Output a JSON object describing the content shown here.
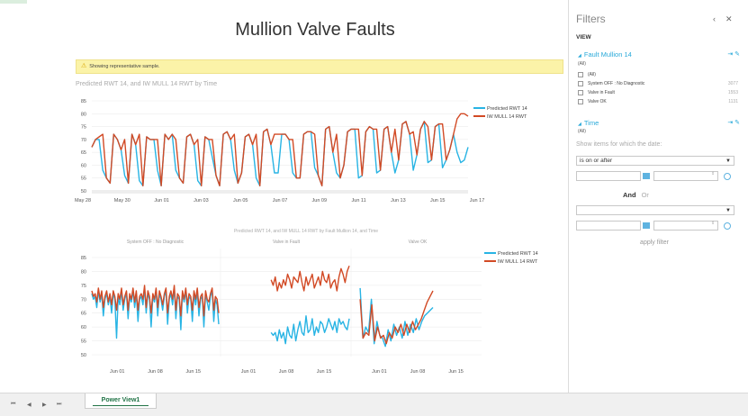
{
  "report": {
    "title": "Mullion Valve Faults",
    "notice": "Showing representative sample.",
    "chart1_title": "Predicted RWT 14, and IW MULL 14 RWT by Time",
    "chart2_title": "Predicted RWT 14, and IW MULL 14 RWT by Fault Mullion 14, and Time"
  },
  "colors": {
    "predicted": "#28b4e4",
    "iw_mull": "#d24a25",
    "accent": "#28a9d9",
    "sheet_tab": "#217346"
  },
  "chart_data": [
    {
      "type": "line",
      "title": "Predicted RWT 14, and IW MULL 14 RWT by Time",
      "x_ticks": [
        "May 28",
        "May 30",
        "Jun 01",
        "Jun 03",
        "Jun 05",
        "Jun 07",
        "Jun 09",
        "Jun 11",
        "Jun 13",
        "Jun 15",
        "Jun 17"
      ],
      "y_ticks": [
        50,
        55,
        60,
        65,
        70,
        75,
        80,
        85
      ],
      "ylim": [
        50,
        85
      ],
      "legend": "right",
      "series": [
        {
          "name": "Predicted RWT 14",
          "values": [
            67,
            70,
            70,
            58,
            55,
            53,
            72,
            70,
            66,
            56,
            53,
            72,
            68,
            54,
            52,
            71,
            70,
            70,
            58,
            52,
            72,
            70,
            72,
            58,
            55,
            53,
            71,
            72,
            68,
            54,
            52,
            71,
            70,
            63,
            56,
            52,
            72,
            73,
            70,
            58,
            53,
            57,
            71,
            72,
            68,
            55,
            52,
            73,
            74,
            68,
            57,
            57,
            72,
            72,
            70,
            57,
            55,
            55,
            72,
            73,
            73,
            59,
            56,
            52,
            74,
            75,
            65,
            57,
            55,
            60,
            73,
            74,
            74,
            55,
            56,
            73,
            75,
            74,
            57,
            58,
            74,
            75,
            65,
            57,
            62,
            76,
            77,
            72,
            58,
            64,
            74,
            77,
            61,
            62,
            75,
            76,
            59,
            62,
            66,
            72,
            65,
            61,
            62,
            67
          ]
        },
        {
          "name": "IW MULL 14 RWT",
          "values": [
            67,
            70,
            71,
            72,
            55,
            53,
            72,
            70,
            66,
            70,
            53,
            72,
            68,
            72,
            52,
            71,
            70,
            70,
            70,
            52,
            72,
            70,
            72,
            70,
            55,
            53,
            71,
            72,
            68,
            70,
            52,
            71,
            70,
            70,
            56,
            52,
            72,
            73,
            70,
            72,
            53,
            57,
            71,
            72,
            68,
            72,
            52,
            73,
            74,
            68,
            72,
            72,
            72,
            72,
            70,
            70,
            55,
            55,
            72,
            73,
            73,
            72,
            56,
            52,
            74,
            75,
            65,
            72,
            55,
            60,
            73,
            74,
            74,
            74,
            56,
            73,
            75,
            74,
            74,
            58,
            74,
            75,
            65,
            74,
            62,
            76,
            77,
            72,
            73,
            64,
            74,
            77,
            75,
            62,
            75,
            76,
            76,
            62,
            66,
            72,
            78,
            80,
            80,
            79
          ]
        }
      ]
    },
    {
      "type": "line",
      "title": "Predicted RWT 14, and IW MULL 14 RWT by Fault Mullion 14, and Time",
      "y_ticks": [
        50,
        55,
        60,
        65,
        70,
        75,
        80,
        85
      ],
      "ylim": [
        50,
        85
      ],
      "legend": "right",
      "panels": [
        {
          "name": "System OFF : No Diagnostic",
          "x_ticks": [
            "Jun 01",
            "Jun 08",
            "Jun 15"
          ],
          "series": [
            {
              "name": "Predicted RWT 14",
              "values": [
                72,
                70,
                71,
                67,
                73,
                69,
                72,
                64,
                70,
                72,
                68,
                71,
                65,
                72,
                70,
                56,
                71,
                68,
                73,
                66,
                70,
                72,
                63,
                71,
                69,
                73,
                67,
                72,
                62,
                70,
                71,
                68,
                74,
                65,
                72,
                70,
                60,
                71,
                69,
                73,
                64,
                72,
                70,
                66,
                71,
                73,
                61,
                70,
                72,
                68,
                74,
                63,
                71,
                70,
                59,
                72,
                69,
                73,
                65,
                71,
                70,
                62,
                72,
                68,
                73,
                64,
                70,
                71,
                60,
                72,
                69,
                66,
                71,
                73,
                62,
                70,
                68,
                61
              ]
            },
            {
              "name": "IW MULL 14 RWT",
              "values": [
                73,
                71,
                72,
                69,
                74,
                70,
                73,
                67,
                71,
                73,
                69,
                72,
                68,
                73,
                71,
                66,
                72,
                70,
                74,
                68,
                71,
                73,
                66,
                72,
                70,
                74,
                69,
                73,
                66,
                71,
                72,
                70,
                75,
                67,
                73,
                71,
                65,
                72,
                70,
                74,
                67,
                73,
                71,
                68,
                72,
                74,
                65,
                71,
                73,
                70,
                75,
                66,
                72,
                71,
                64,
                73,
                70,
                74,
                68,
                72,
                71,
                66,
                73,
                70,
                74,
                67,
                71,
                72,
                64,
                73,
                70,
                69,
                72,
                74,
                66,
                71,
                70,
                65
              ]
            }
          ]
        },
        {
          "name": "Valve in Fault",
          "x_ticks": [
            "Jun 01",
            "Jun 08",
            "Jun 15"
          ],
          "series": [
            {
              "name": "Predicted RWT 14",
              "values": [
                58,
                57,
                58,
                55,
                59,
                56,
                58,
                54,
                60,
                57,
                56,
                61,
                55,
                59,
                62,
                58,
                57,
                64,
                58,
                59,
                63,
                57,
                60,
                58,
                62,
                61,
                58,
                60,
                63,
                61,
                59,
                62,
                58,
                63,
                61,
                62,
                60,
                59,
                63
              ]
            },
            {
              "name": "IW MULL 14 RWT",
              "values": [
                77,
                75,
                78,
                73,
                76,
                74,
                77,
                75,
                79,
                77,
                74,
                78,
                77,
                76,
                80,
                76,
                73,
                78,
                75,
                77,
                79,
                74,
                76,
                78,
                75,
                80,
                77,
                76,
                79,
                74,
                76,
                77,
                73,
                78,
                81,
                79,
                76,
                80,
                82
              ]
            }
          ]
        },
        {
          "name": "Valve OK",
          "x_ticks": [
            "Jun 01",
            "Jun 08",
            "Jun 15"
          ],
          "series": [
            {
              "name": "Predicted RWT 14",
              "values": [
                74,
                56,
                60,
                58,
                70,
                54,
                62,
                57,
                56,
                53,
                59,
                55,
                61,
                57,
                60,
                56,
                62,
                57,
                61,
                58,
                63,
                59,
                62,
                64,
                65,
                66,
                67
              ]
            },
            {
              "name": "IW MULL 14 RWT",
              "values": [
                70,
                56,
                58,
                57,
                68,
                55,
                60,
                56,
                57,
                54,
                58,
                56,
                60,
                58,
                61,
                57,
                61,
                58,
                62,
                59,
                61,
                63,
                66,
                69,
                71,
                73
              ]
            }
          ]
        }
      ]
    }
  ],
  "filters": {
    "title": "Filters",
    "view_label": "VIEW",
    "field1": {
      "name": "Fault Mullion 14",
      "state": "(All)",
      "items": [
        {
          "label": "(All)",
          "count": ""
        },
        {
          "label": "System OFF : No Diagnostic",
          "count": "3077"
        },
        {
          "label": "Valve in Fault",
          "count": "1553"
        },
        {
          "label": "Valve OK",
          "count": "1131"
        }
      ]
    },
    "field2": {
      "name": "Time",
      "state": "(All)",
      "show_items_label": "Show items for which the date:",
      "condition": "is on or after",
      "and_label": "And",
      "or_label": "Or",
      "apply_label": "apply filter"
    }
  },
  "tabs": {
    "sheet": "Power View1"
  }
}
